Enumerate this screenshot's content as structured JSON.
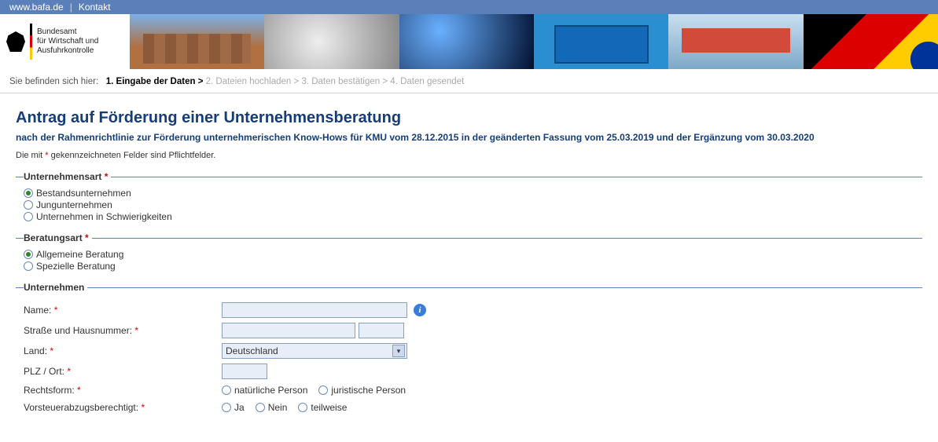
{
  "topbar": {
    "site": "www.bafa.de",
    "contact": "Kontakt"
  },
  "logo": {
    "line1": "Bundesamt",
    "line2": "für Wirtschaft und",
    "line3": "Ausfuhrkontrolle"
  },
  "breadcrumb": {
    "prefix": "Sie befinden sich hier:",
    "steps": [
      "1. Eingabe der Daten >",
      "2. Dateien hochladen >",
      "3. Daten bestätigen >",
      "4. Daten gesendet"
    ]
  },
  "title": "Antrag auf Förderung einer Unternehmensberatung",
  "subtitle": "nach der Rahmenrichtlinie zur Förderung unternehmerischen Know-Hows für KMU vom 28.12.2015 in der geänderten Fassung vom 25.03.2019 und der Ergänzung vom 30.03.2020",
  "hint_pre": "Die mit ",
  "hint_post": " gekennzeichneten Felder sind Pflichtfelder.",
  "sections": {
    "unternehmensart": {
      "legend": "Unternehmensart",
      "options": [
        "Bestandsunternehmen",
        "Jungunternehmen",
        "Unternehmen in Schwierigkeiten"
      ]
    },
    "beratungsart": {
      "legend": "Beratungsart",
      "options": [
        "Allgemeine Beratung",
        "Spezielle Beratung"
      ]
    },
    "unternehmen": {
      "legend": "Unternehmen",
      "fields": {
        "name": "Name:",
        "strasse": "Straße und Hausnummer:",
        "land": "Land:",
        "land_value": "Deutschland",
        "plz": "PLZ / Ort:",
        "rechtsform": "Rechtsform:",
        "rechtsform_opts": [
          "natürliche Person",
          "juristische Person"
        ],
        "vorsteuer": "Vorsteuerabzugsberechtigt:",
        "vorsteuer_opts": [
          "Ja",
          "Nein",
          "teilweise"
        ]
      }
    }
  }
}
